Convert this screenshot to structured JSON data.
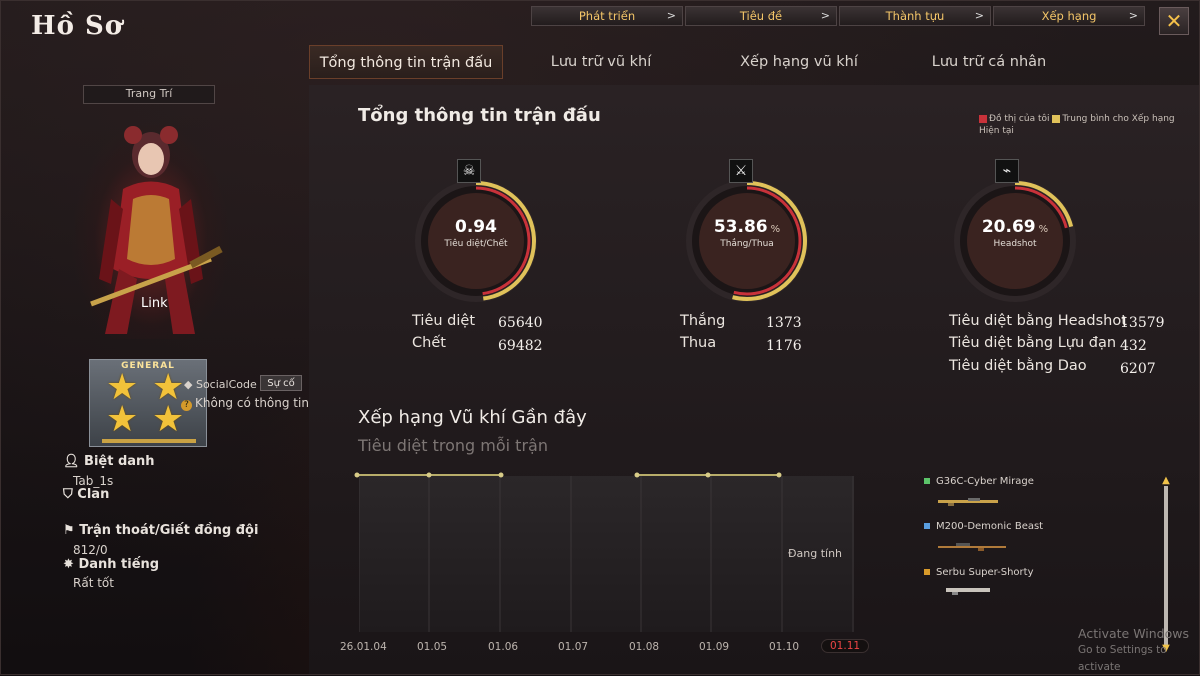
{
  "app": {
    "title": "Hồ Sơ",
    "close_glyph": "✕"
  },
  "topnav": [
    {
      "label": "Phát triển",
      "chevron": ">"
    },
    {
      "label": "Tiêu đề",
      "chevron": ">"
    },
    {
      "label": "Thành tựu",
      "chevron": ">"
    },
    {
      "label": "Xếp hạng",
      "chevron": ">"
    }
  ],
  "tabs": [
    {
      "label": "Tổng thông tin trận đấu",
      "active": true
    },
    {
      "label": "Lưu trữ vũ khí",
      "active": false
    },
    {
      "label": "Xếp hạng vũ khí",
      "active": false
    },
    {
      "label": "Lưu trữ cá nhân",
      "active": false
    }
  ],
  "profile": {
    "decorate_label": "Trang Trí",
    "character_name": "Link",
    "rank_label": "GENERAL",
    "nickname_label": "Biệt danh",
    "nickname_value": "Tab_1s",
    "socialcode_label": "SocialCode",
    "socialcode_button": "Sự cố",
    "no_info": "Không có thông tin",
    "clan_label": "Clan",
    "escape_label": "Trận thoát/Giết đồng đội",
    "escape_value": "812/0",
    "reputation_label": "Danh tiếng",
    "reputation_value": "Rất tốt"
  },
  "summary": {
    "title": "Tổng thông tin trận đấu",
    "legend_mine": "Đồ thị của tôi",
    "legend_avg": "Trung bình cho Xếp hạng Hiện tại",
    "legend_mine_color": "#c8323a",
    "legend_avg_color": "#e0c25a",
    "gauges": [
      {
        "value": "0.94",
        "unit": "",
        "label": "Tiêu diệt/Chết",
        "icon": "skull-icon",
        "fill": 0.48
      },
      {
        "value": "53.86",
        "unit": "%",
        "label": "Thắng/Thua",
        "icon": "crossed-guns-icon",
        "fill": 0.54
      },
      {
        "value": "20.69",
        "unit": "%",
        "label": "Headshot",
        "icon": "rifle-icon",
        "fill": 0.21
      }
    ],
    "stats": {
      "kills_label": "Tiêu diệt",
      "kills": "65640",
      "deaths_label": "Chết",
      "deaths": "69482",
      "wins_label": "Thắng",
      "wins": "1373",
      "losses_label": "Thua",
      "losses": "1176",
      "hs_kills_label": "Tiêu diệt bằng Headshot",
      "hs_kills": "13579",
      "grenade_kills_label": "Tiêu diệt bằng Lựu đạn",
      "grenade_kills": "432",
      "knife_kills_label": "Tiêu diệt bằng Dao",
      "knife_kills": "6207"
    }
  },
  "recent": {
    "title": "Xếp hạng Vũ khí Gần đây",
    "subtitle": "Tiêu diệt trong mỗi trận",
    "calculating": "Đang tính",
    "dates": [
      "26.01.04",
      "01.05",
      "01.06",
      "01.07",
      "01.08",
      "01.09",
      "01.10",
      "01.11"
    ],
    "selected_date": "01.11",
    "weapons": [
      {
        "name": "G36C-Cyber Mirage",
        "color": "#5cc46a"
      },
      {
        "name": "M200-Demonic Beast",
        "color": "#5a9ee0"
      },
      {
        "name": "Serbu Super-Shorty",
        "color": "#d89a2a"
      }
    ]
  },
  "watermark": {
    "line1": "Activate Windows",
    "line2": "Go to Settings to activate"
  }
}
